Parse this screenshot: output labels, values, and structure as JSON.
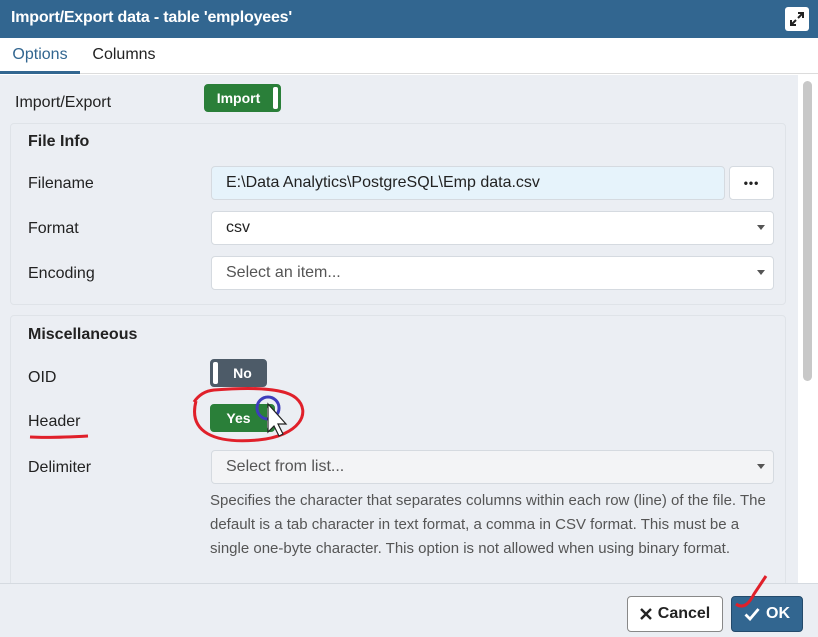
{
  "window": {
    "title": "Import/Export data - table 'employees'"
  },
  "tabs": [
    {
      "label": "Options",
      "active": true
    },
    {
      "label": "Columns",
      "active": false
    }
  ],
  "import_export": {
    "label": "Import/Export",
    "toggle": "Import"
  },
  "file_info": {
    "legend": "File Info",
    "filename": {
      "label": "Filename",
      "value": "E:\\Data Analytics\\PostgreSQL\\Emp data.csv",
      "browse": "•••"
    },
    "format": {
      "label": "Format",
      "value": "csv"
    },
    "encoding": {
      "label": "Encoding",
      "placeholder": "Select an item..."
    }
  },
  "misc": {
    "legend": "Miscellaneous",
    "oid": {
      "label": "OID",
      "toggle": "No"
    },
    "header": {
      "label": "Header",
      "toggle": "Yes"
    },
    "delimiter": {
      "label": "Delimiter",
      "placeholder": "Select from list...",
      "help": "Specifies the character that separates columns within each row (line) of the file. The default is a tab character in text format, a comma in CSV format. This must be a single one-byte character. This option is not allowed when using binary format."
    }
  },
  "footer": {
    "cancel": "Cancel",
    "ok": "OK"
  },
  "colors": {
    "titlebar": "#326690",
    "toggle_on": "#2a7f39",
    "toggle_off": "#4d5b68",
    "annotation": "#e0202a"
  },
  "icons": [
    "expand-icon",
    "close-x-icon",
    "checkmark-icon",
    "dropdown-caret-icon",
    "mouse-cursor-icon"
  ]
}
